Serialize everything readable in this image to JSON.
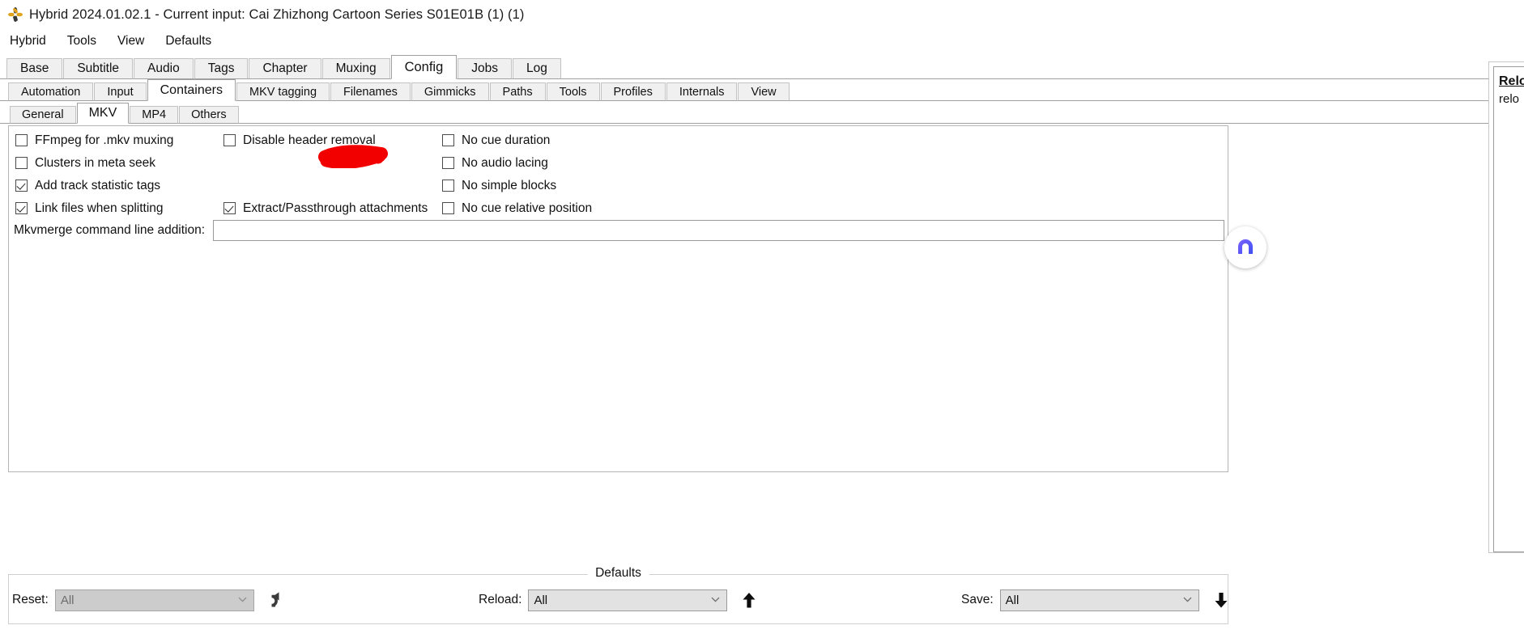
{
  "window": {
    "icon": "hybrid-flower-icon",
    "title": "Hybrid 2024.01.02.1 - Current input: Cai Zhizhong Cartoon Series S01E01B (1) (1)"
  },
  "menubar": {
    "items": [
      {
        "label": "Hybrid"
      },
      {
        "label": "Tools"
      },
      {
        "label": "View"
      },
      {
        "label": "Defaults"
      }
    ]
  },
  "tabs_level1": {
    "active": "Config",
    "items": [
      {
        "label": "Base"
      },
      {
        "label": "Subtitle"
      },
      {
        "label": "Audio"
      },
      {
        "label": "Tags"
      },
      {
        "label": "Chapter"
      },
      {
        "label": "Muxing"
      },
      {
        "label": "Config"
      },
      {
        "label": "Jobs"
      },
      {
        "label": "Log"
      }
    ]
  },
  "tabs_level2": {
    "active": "Containers",
    "items": [
      {
        "label": "Automation"
      },
      {
        "label": "Input"
      },
      {
        "label": "Containers"
      },
      {
        "label": "MKV tagging"
      },
      {
        "label": "Filenames"
      },
      {
        "label": "Gimmicks"
      },
      {
        "label": "Paths"
      },
      {
        "label": "Tools"
      },
      {
        "label": "Profiles"
      },
      {
        "label": "Internals"
      },
      {
        "label": "View"
      }
    ]
  },
  "tabs_level3": {
    "active": "MKV",
    "items": [
      {
        "label": "General"
      },
      {
        "label": "MKV"
      },
      {
        "label": "MP4"
      },
      {
        "label": "Others"
      }
    ]
  },
  "mkv_panel": {
    "checkboxes": [
      {
        "label": "FFmpeg for .mkv muxing",
        "checked": false,
        "col": 0,
        "row": 0
      },
      {
        "label": "Clusters in meta seek",
        "checked": false,
        "col": 0,
        "row": 1
      },
      {
        "label": "Add track statistic tags",
        "checked": true,
        "col": 0,
        "row": 2
      },
      {
        "label": "Link files when splitting",
        "checked": true,
        "col": 0,
        "row": 3
      },
      {
        "label": "Disable header removal",
        "checked": false,
        "col": 1,
        "row": 0
      },
      {
        "label": "Extract/Passthrough attachments",
        "checked": true,
        "col": 1,
        "row": 3
      },
      {
        "label": "No cue duration",
        "checked": false,
        "col": 2,
        "row": 0
      },
      {
        "label": "No audio lacing",
        "checked": false,
        "col": 2,
        "row": 1
      },
      {
        "label": "No simple blocks",
        "checked": false,
        "col": 2,
        "row": 2
      },
      {
        "label": "No cue relative position",
        "checked": false,
        "col": 2,
        "row": 3
      }
    ],
    "cmdline": {
      "label": "Mkvmerge command line addition:",
      "value": "",
      "placeholder": ""
    },
    "annotation": {
      "shape": "red-scribble-highlight",
      "color": "#f20000"
    }
  },
  "defaults": {
    "legend": "Defaults",
    "reset": {
      "caption": "Reset:",
      "value": "All",
      "disabled": true,
      "icon": "undo-arrow-icon"
    },
    "reload": {
      "caption": "Reload:",
      "value": "All",
      "icon": "arrow-up-icon"
    },
    "save": {
      "caption": "Save:",
      "value": "All",
      "icon": "arrow-down-icon"
    }
  },
  "help_panel": {
    "title": "Relo",
    "body": "relo"
  },
  "float_badge": {
    "icon": "arch-badge-icon",
    "color": "#5b5bd6"
  }
}
